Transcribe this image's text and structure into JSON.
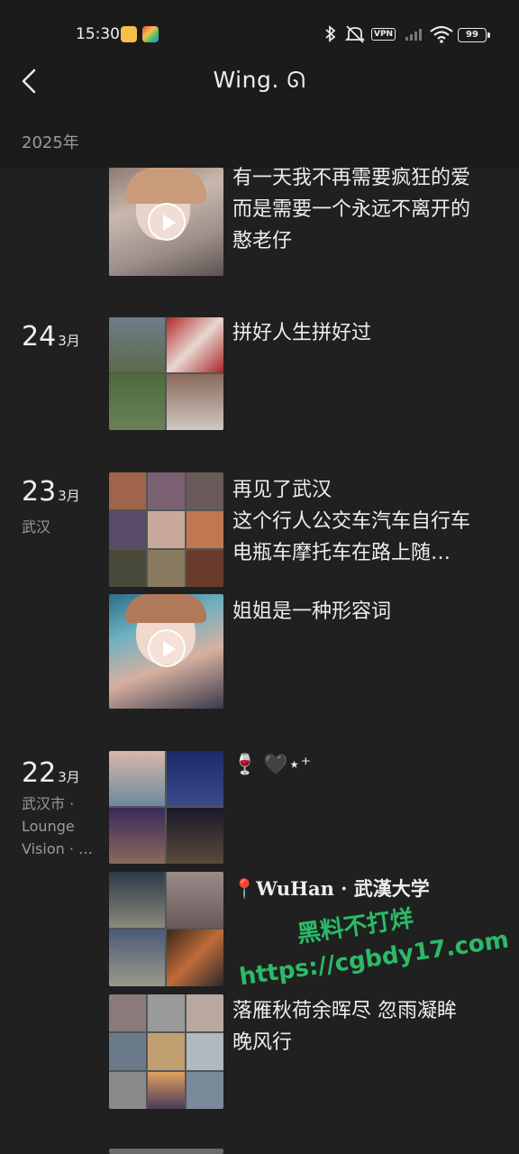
{
  "status_bar": {
    "time": "15:30",
    "vpn_label": "VPN",
    "battery": "99",
    "icons": [
      "bluetooth-icon",
      "mute-icon",
      "signal-icon",
      "wifi-icon"
    ]
  },
  "header": {
    "title": "Wing. ᘏ",
    "year": "2025年"
  },
  "entries": [
    {
      "posts": [
        {
          "text": "有一天我不再需要疯狂的爱\n而是需要一个永远不离开的\n憨老仔",
          "type": "video"
        }
      ]
    },
    {
      "day": "24",
      "month": "3月",
      "posts": [
        {
          "text": "拼好人生拼好过",
          "type": "grid4"
        }
      ]
    },
    {
      "day": "23",
      "month": "3月",
      "location": "武汉",
      "posts": [
        {
          "text": "再见了武汉\n这个行人公交车汽车自行车\n电瓶车摩托车在路上随…",
          "type": "grid9"
        },
        {
          "text": "姐姐是一种形容词",
          "type": "video"
        }
      ]
    },
    {
      "day": "22",
      "month": "3月",
      "location": "武汉市 ·\nLounge\nVision · …",
      "posts": [
        {
          "text": "🍷 🖤⋆⁺",
          "type": "grid4"
        },
        {
          "text": "📍WuHan · 武漢大学",
          "type": "grid4"
        },
        {
          "text": "落雁秋荷余晖尽 忽雨凝眸\n晚风行",
          "type": "grid9"
        }
      ]
    }
  ],
  "watermark": {
    "line1": "黑料不打烊",
    "line2": "https://cgbdy17.com"
  },
  "colors": {
    "background": "#202020",
    "header": "#1b1b1b",
    "watermark": "#2fb86a"
  }
}
